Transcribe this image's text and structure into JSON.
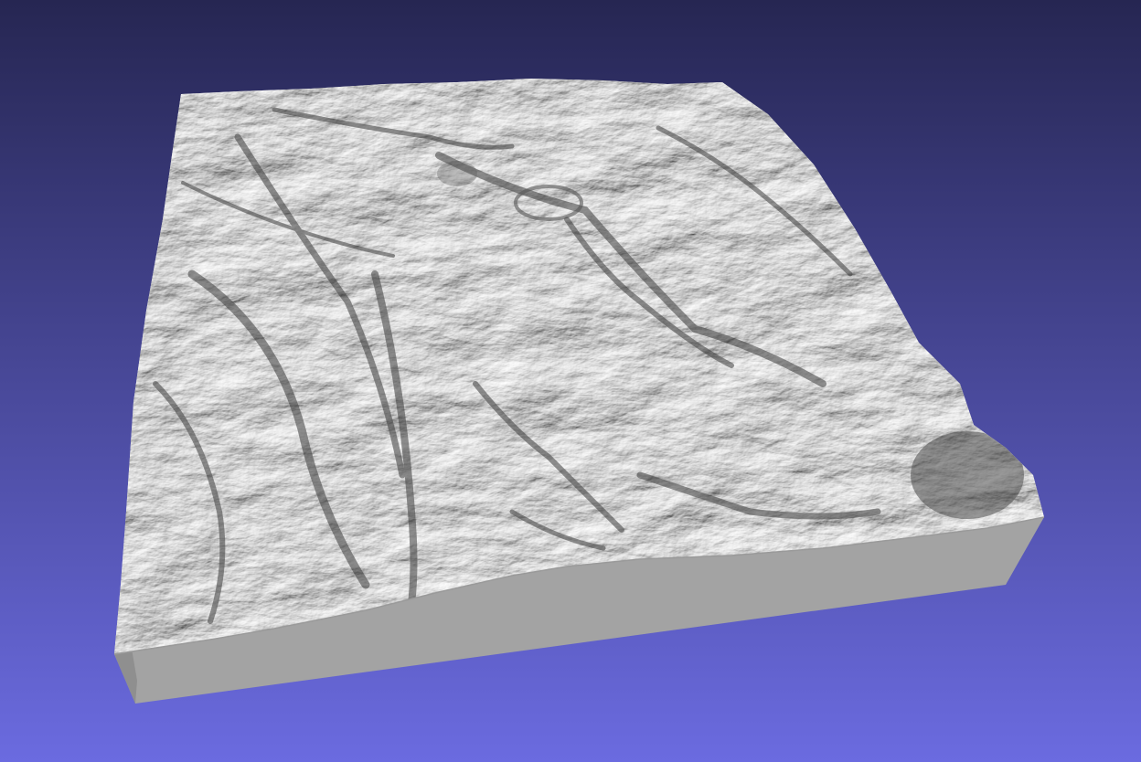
{
  "viewport": {
    "background_top_color": "#262652",
    "background_bottom_color": "#6b6be0",
    "model_surface_color": "#d8d8d8",
    "model_ridge_shade_color": "#3c3c3c",
    "model_side_color": "#a3a3a3",
    "model_front_color": "#8f8f8f"
  },
  "model": {
    "name": "terrain-relief-mesh",
    "features": [
      "ridges",
      "valleys",
      "crater"
    ]
  }
}
